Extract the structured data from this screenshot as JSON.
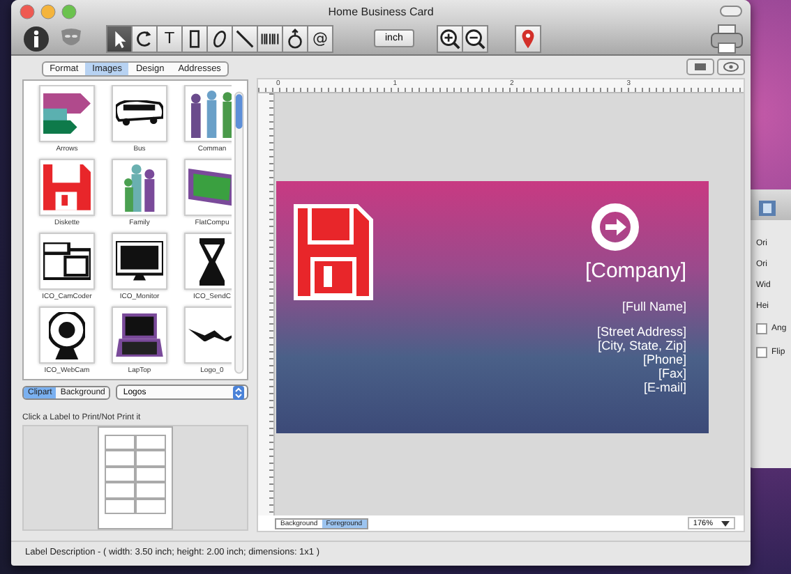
{
  "window": {
    "title": "Home Business Card"
  },
  "toolbar": {
    "tools": [
      {
        "kind": "pointer",
        "selected": true
      },
      {
        "kind": "rotate",
        "selected": false
      },
      {
        "kind": "text",
        "label": "T",
        "selected": false
      },
      {
        "kind": "rectangle",
        "selected": false
      },
      {
        "kind": "ellipse",
        "selected": false
      },
      {
        "kind": "line",
        "selected": false
      },
      {
        "kind": "barcode",
        "selected": false
      },
      {
        "kind": "image",
        "selected": false
      },
      {
        "kind": "at",
        "label": "@",
        "selected": false
      }
    ],
    "unit_button": "inch"
  },
  "tabs": [
    {
      "label": "Format",
      "selected": false
    },
    {
      "label": "Images",
      "selected": true
    },
    {
      "label": "Design",
      "selected": false
    },
    {
      "label": "Addresses",
      "selected": false
    }
  ],
  "clipart": [
    {
      "kind": "arrows",
      "label": "Arrows"
    },
    {
      "kind": "bus",
      "label": "Bus"
    },
    {
      "kind": "people",
      "label": "Comman"
    },
    {
      "kind": "diskette",
      "label": "Diskette"
    },
    {
      "kind": "family",
      "label": "Family"
    },
    {
      "kind": "flatcomputer",
      "label": "FlatCompu"
    },
    {
      "kind": "camcorder",
      "label": "ICO_CamCoder"
    },
    {
      "kind": "monitor",
      "label": "ICO_Monitor"
    },
    {
      "kind": "hourglass",
      "label": "ICO_SendC"
    },
    {
      "kind": "webcam",
      "label": "ICO_WebCam"
    },
    {
      "kind": "laptop",
      "label": "LapTop"
    },
    {
      "kind": "logo",
      "label": "Logo_0"
    }
  ],
  "source_toggle": [
    {
      "label": "Clipart",
      "selected": true
    },
    {
      "label": "Background",
      "selected": false
    }
  ],
  "category": "Logos",
  "hint": "Click a Label to Print/Not Print it",
  "ruler": [
    "0",
    "1",
    "2",
    "3"
  ],
  "card": {
    "company": "[Company]",
    "fields": [
      "[Full Name]",
      "[Street Address]",
      "[City, State, Zip]",
      "[Phone]",
      "[Fax]",
      "[E-mail]"
    ]
  },
  "layer_tabs": [
    {
      "label": "Background",
      "selected": false
    },
    {
      "label": "Foreground",
      "selected": true
    }
  ],
  "zoom": "176%",
  "status_bar": "Label Description - ( width: 3.50 inch; height: 2.00 inch; dimensions: 1x1 )",
  "inspector": {
    "rows": [
      {
        "label": "Ori"
      },
      {
        "label": "Ori"
      },
      {
        "label": "Wid"
      },
      {
        "label": "Hei"
      },
      {
        "label": "Ang",
        "checked": false
      },
      {
        "label": "Flip",
        "checked": false
      }
    ]
  }
}
